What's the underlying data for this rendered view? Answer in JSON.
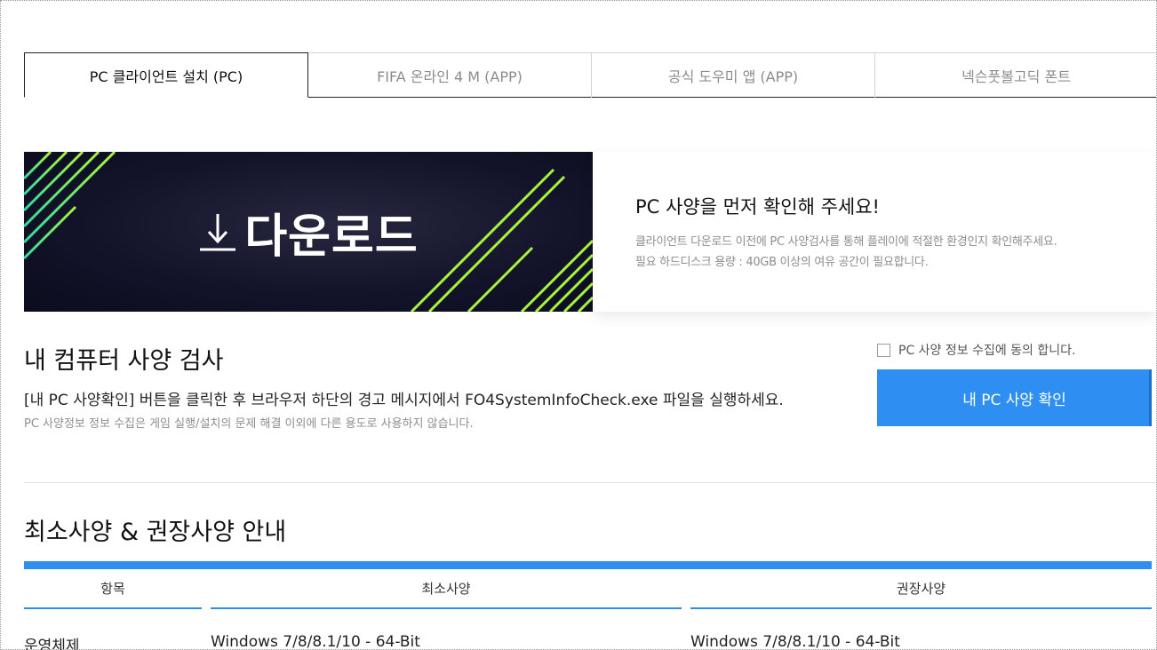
{
  "tabs": [
    {
      "label": "PC 클라이언트 설치 (PC)",
      "active": true
    },
    {
      "label": "FIFA 온라인 4 M (APP)",
      "active": false
    },
    {
      "label": "공식 도우미 앱 (APP)",
      "active": false
    },
    {
      "label": "넥슨풋볼고딕 폰트",
      "active": false
    }
  ],
  "banner": {
    "label": "다운로드",
    "icon": "download-arrow-icon",
    "stripe_color": "#a6f43c"
  },
  "spec_notice": {
    "title": "PC 사양을 먼저 확인해 주세요!",
    "line1": "클라이언트 다운로드 이전에 PC 사양검사를 통해 플레이에 적절한 환경인지 확인해주세요.",
    "line2": "필요 하드디스크 용량 : 40GB 이상의 여유 공간이 필요합니다."
  },
  "pc_check": {
    "title": "내 컴퓨터 사양 검사",
    "description": "[내 PC 사양확인] 버튼을 클릭한 후 브라우저 하단의 경고 메시지에서 FO4SystemInfoCheck.exe 파일을 실행하세요.",
    "note": "PC 사양정보 정보 수집은 게임 실행/설치의 문제 해결 이외에 다른 용도로 사용하지 않습니다.",
    "agree_label": "PC 사양 정보 수집에 동의 합니다.",
    "button_label": "내 PC 사양 확인"
  },
  "spec_table": {
    "title": "최소사양 & 권장사양 안내",
    "headers": [
      "항목",
      "최소사양",
      "권장사양"
    ],
    "rows": [
      {
        "item": "운영체제",
        "min": "Windows 7/8/8.1/10 - 64-Bit",
        "rec": "Windows 7/8/8.1/10 - 64-Bit"
      }
    ]
  },
  "colors": {
    "accent": "#2e8ef1",
    "banner_bg": "#13132a",
    "stripe": "#a6f43c"
  }
}
